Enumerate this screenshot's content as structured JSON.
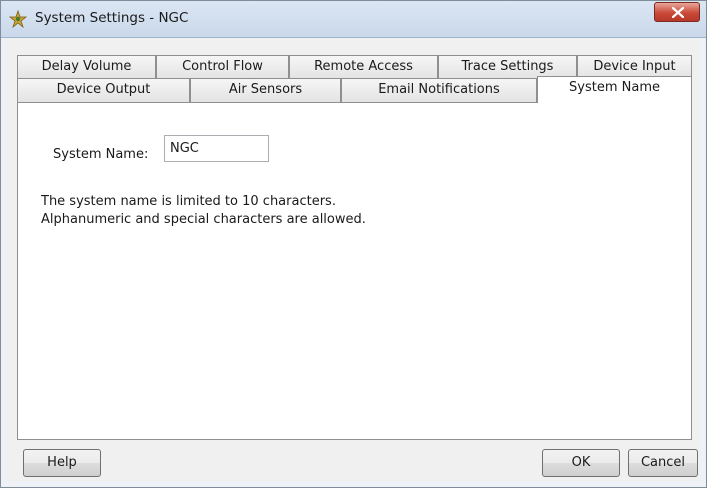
{
  "window": {
    "title": "System Settings - NGC",
    "close_symbol": "x"
  },
  "tabs": {
    "row1": [
      "Delay Volume",
      "Control Flow",
      "Remote Access",
      "Trace Settings",
      "Device Input"
    ],
    "row2": [
      "Device Output",
      "Air Sensors",
      "Email Notifications",
      "System Name"
    ],
    "selected": "System Name"
  },
  "form": {
    "system_name_label": "System Name:",
    "system_name_value": "NGC",
    "info_line1": "The system name is limited to 10 characters.",
    "info_line2": "Alphanumeric and special characters are allowed."
  },
  "buttons": {
    "help": "Help",
    "ok": "OK",
    "cancel": "Cancel"
  },
  "icons": {
    "app": "app-logo-icon",
    "close": "close-icon"
  }
}
